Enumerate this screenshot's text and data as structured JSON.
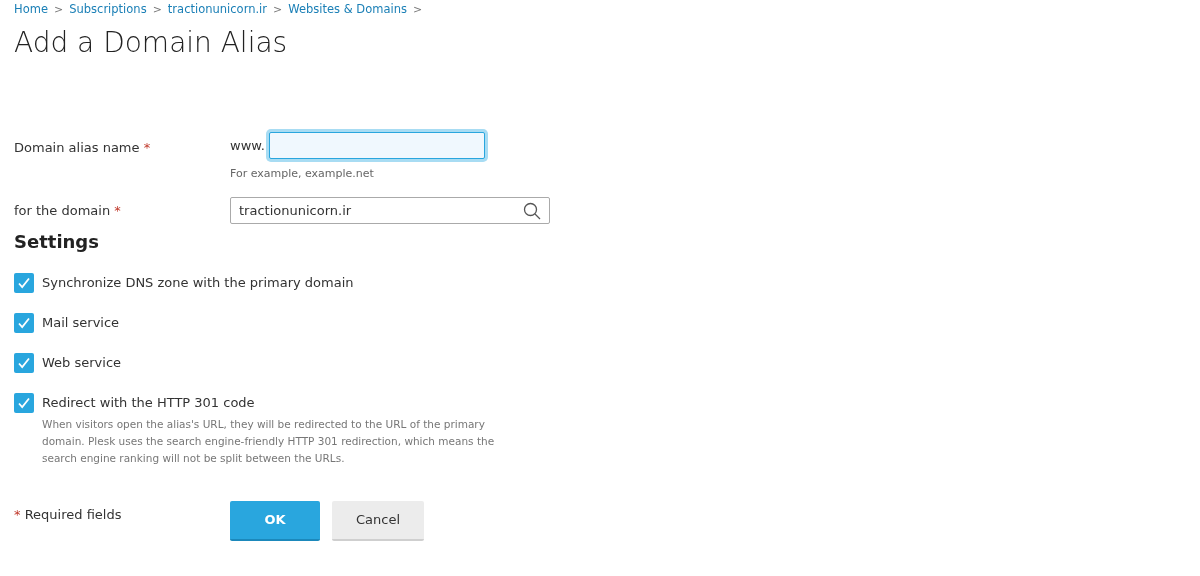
{
  "breadcrumb": [
    {
      "label": "Home",
      "separator": ">"
    },
    {
      "label": "Subscriptions",
      "separator": ">"
    },
    {
      "label": "tractionunicorn.ir",
      "separator": ">"
    },
    {
      "label": "Websites & Domains",
      "separator": ">"
    }
  ],
  "title": "Add a Domain Alias",
  "fields": [
    {
      "kind": "text",
      "label": "Domain alias name",
      "required_mark": "*",
      "prefix": "www.",
      "focused": true,
      "hint": "For example, example.net"
    },
    {
      "kind": "search",
      "label": "for the domain",
      "required_mark": "*",
      "value": "tractionunicorn.ir"
    }
  ],
  "settings": {
    "heading": "Settings",
    "options": [
      {
        "label": "Synchronize DNS zone with the primary domain",
        "checked": true
      },
      {
        "label": "Mail service",
        "checked": true
      },
      {
        "label": "Web service",
        "checked": true
      },
      {
        "label": "Redirect with the HTTP 301 code",
        "checked": true,
        "description": "When visitors open the alias's URL, they will be redirected to the URL of the primary domain. Plesk uses the search engine-friendly HTTP 301 redirection, which means the search engine ranking will not be split between the URLs."
      }
    ]
  },
  "footer": {
    "required_mark": "*",
    "required_note": "Required fields"
  },
  "buttons": [
    {
      "label": "OK",
      "kind": "primary"
    },
    {
      "label": "Cancel",
      "kind": "secondary"
    }
  ]
}
